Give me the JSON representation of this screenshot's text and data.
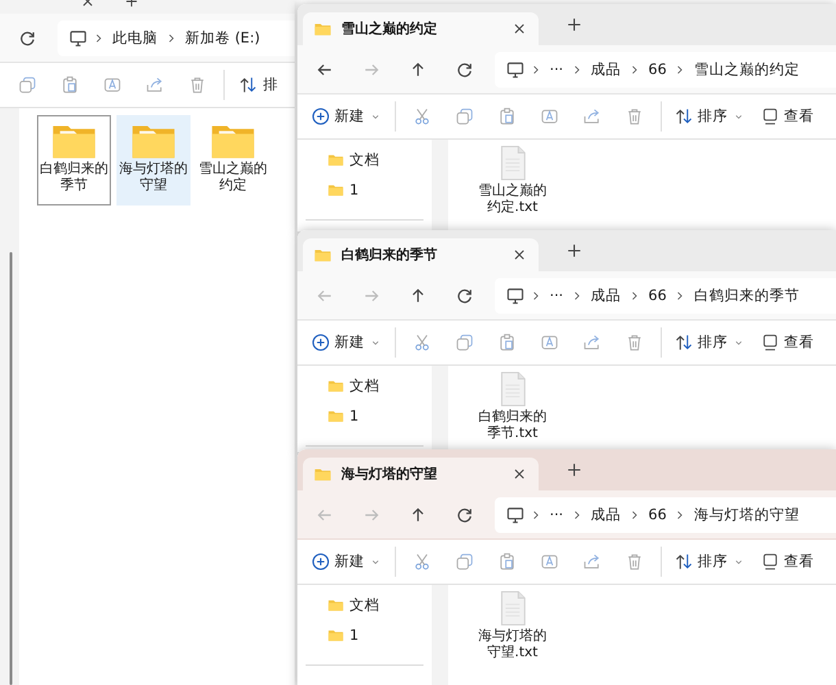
{
  "background_window": {
    "address_path": [
      "此电脑",
      "新加卷 (E:)"
    ],
    "sort_label": "排",
    "folders": [
      {
        "name": "白鹤归来的季节",
        "selected": false,
        "focused": true
      },
      {
        "name": "海与灯塔的守望",
        "selected": true,
        "focused": false
      },
      {
        "name": "雪山之巅的约定",
        "selected": false,
        "focused": false
      }
    ]
  },
  "windows": [
    {
      "tab_title": "雪山之巅的约定",
      "active": false,
      "back_enabled": true,
      "path": [
        "···",
        "成品",
        "66",
        "雪山之巅的约定"
      ],
      "new_label": "新建",
      "sort_label": "排序",
      "view_label": "查看",
      "nav_items": [
        "文档",
        "1"
      ],
      "files": [
        "雪山之巅的约定.txt"
      ]
    },
    {
      "tab_title": "白鹤归来的季节",
      "active": false,
      "back_enabled": false,
      "path": [
        "···",
        "成品",
        "66",
        "白鹤归来的季节"
      ],
      "new_label": "新建",
      "sort_label": "排序",
      "view_label": "查看",
      "nav_items": [
        "文档",
        "1"
      ],
      "files": [
        "白鹤归来的季节.txt"
      ]
    },
    {
      "tab_title": "海与灯塔的守望",
      "active": true,
      "back_enabled": false,
      "path": [
        "···",
        "成品",
        "66",
        "海与灯塔的守望"
      ],
      "new_label": "新建",
      "sort_label": "排序",
      "view_label": "查看",
      "nav_items": [
        "文档",
        "1"
      ],
      "files": [
        "海与灯塔的守望.txt"
      ]
    }
  ]
}
